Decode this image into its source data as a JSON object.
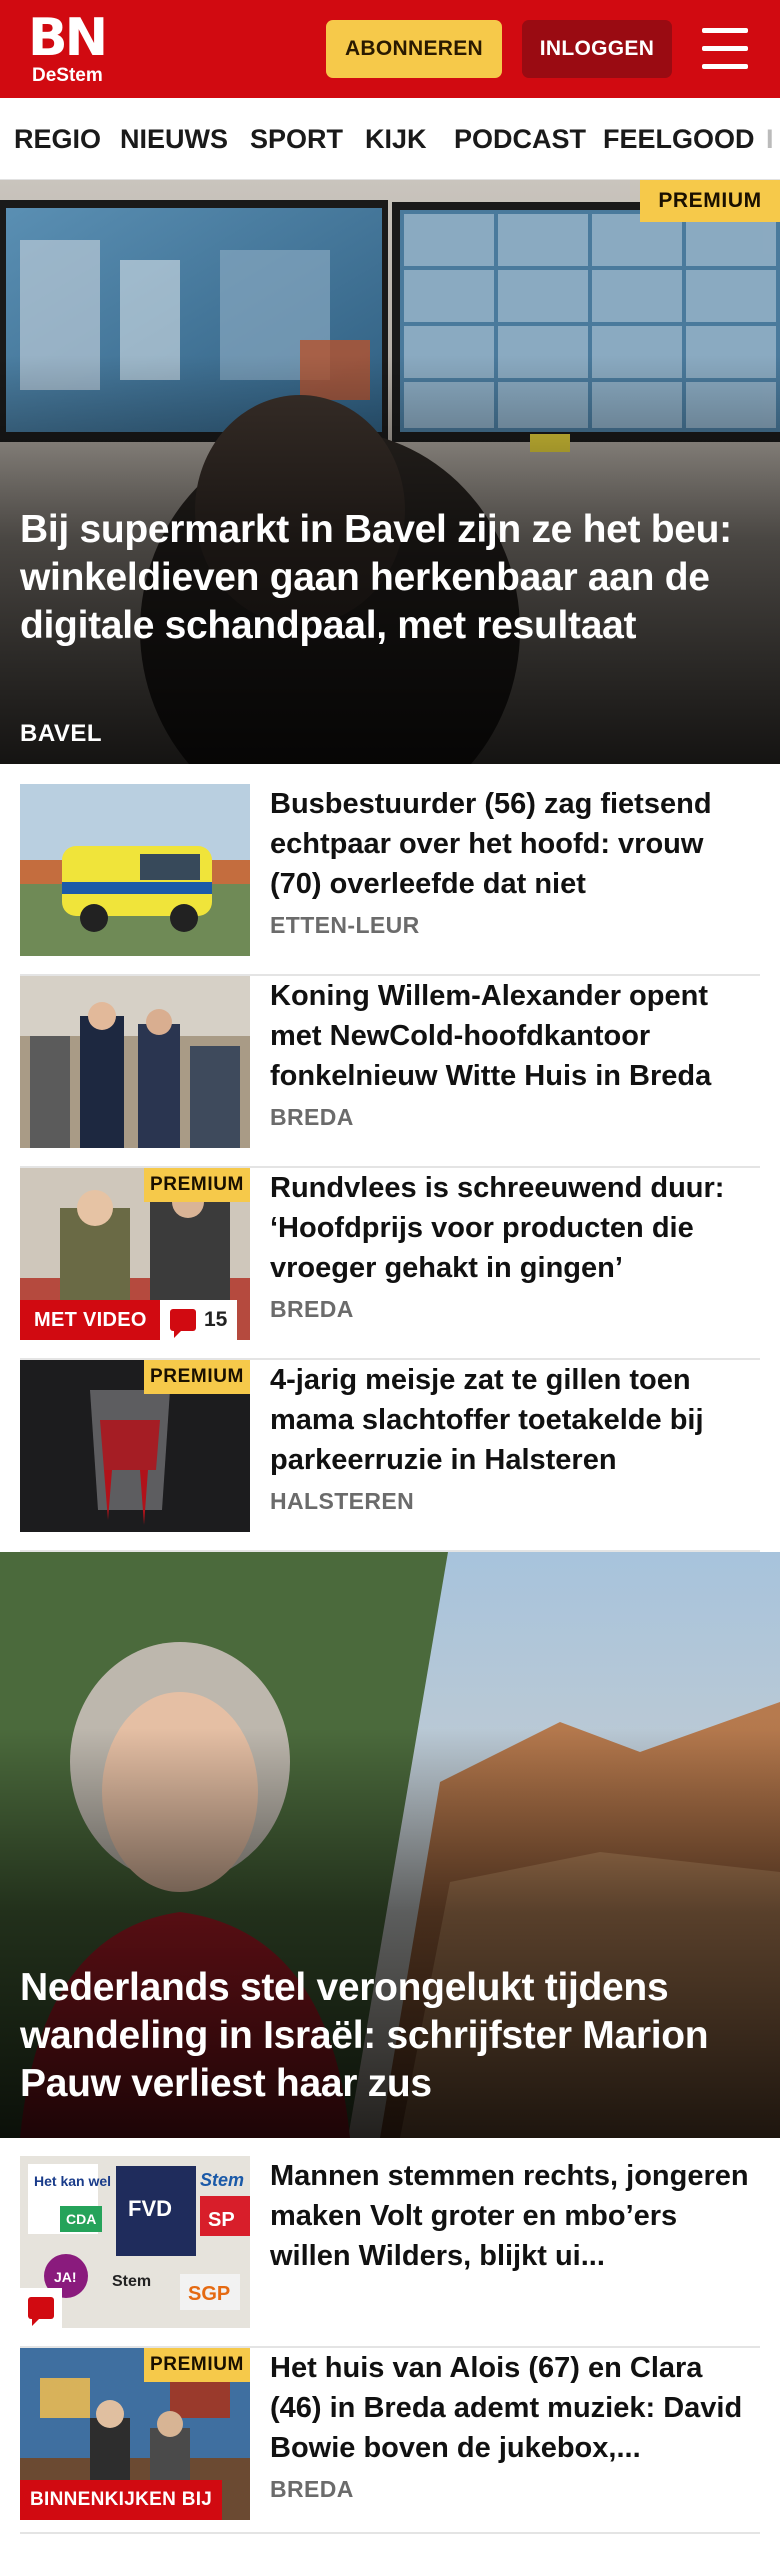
{
  "header": {
    "logo_main": "BN",
    "logo_sub": "DeStem",
    "subscribe_label": "ABONNEREN",
    "login_label": "INLOGGEN",
    "menu_icon": "hamburger-menu-icon"
  },
  "nav": {
    "items": [
      "REGIO",
      "NIEUWS",
      "SPORT",
      "KIJK",
      "PODCAST",
      "FEELGOOD",
      "I"
    ]
  },
  "hero1": {
    "badge": "PREMIUM",
    "title": "Bij supermarkt in Bavel zijn ze het beu: winkeldieven gaan herkenbaar aan de digitale schandpaal, met resultaat",
    "location": "BAVEL"
  },
  "articles": [
    {
      "title": "Busbestuurder (56) zag fietsend echtpaar over het hoofd: vrouw (70) overleefde dat niet",
      "location": "ETTEN-LEUR"
    },
    {
      "title": "Koning Willem-Alexander opent met NewCold-hoofdkantoor fonkelnieuw Witte Huis in Breda",
      "location": "BREDA"
    },
    {
      "title": "Rundvlees is schreeuwend duur: ‘Hoofdprijs voor producten die vroeger gehakt in gingen’",
      "location": "BREDA",
      "premium": "PREMIUM",
      "video_label": "MET VIDEO",
      "comments": "15"
    },
    {
      "title": "4-jarig meisje zat te gillen toen mama slachtoffer toetakelde bij parkeerruzie in Halsteren",
      "location": "HALSTEREN",
      "premium": "PREMIUM"
    }
  ],
  "hero2": {
    "title": "Nederlands stel verongelukt tijdens wandeling in Israël: schrijfster Marion Pauw verliest haar zus"
  },
  "articles2": [
    {
      "title": "Mannen stemmen rechts, jongeren maken Volt groter en mbo’ers willen Wilders, blijkt ui...",
      "thumb_texts": [
        "Het kan wel",
        "CDA",
        "FVD",
        "Stem",
        "SP",
        "JA!",
        "Stem",
        "SGP"
      ]
    },
    {
      "title": "Het huis van Alois (67) en Clara (46) in Breda ademt muziek: David Bowie boven de jukebox,...",
      "location": "BREDA",
      "premium": "PREMIUM",
      "badge": "BINNENKIJKEN BIJ"
    }
  ],
  "colors": {
    "brand_red": "#d10a11",
    "premium_yellow": "#f6c94a",
    "login_dark_red": "#9a0b12"
  }
}
